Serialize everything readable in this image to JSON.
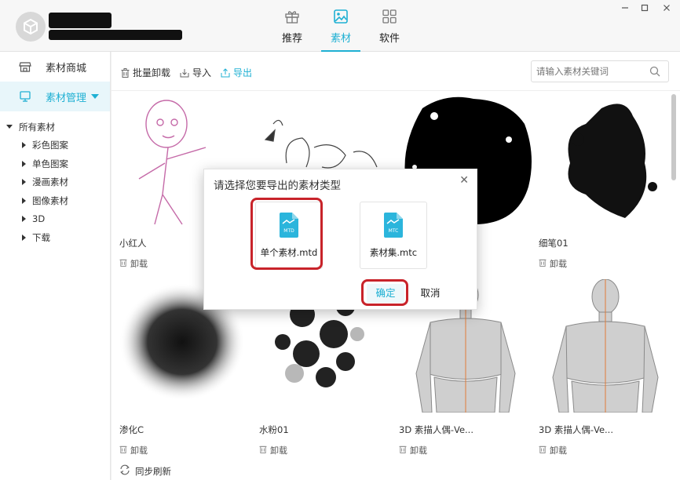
{
  "header": {
    "tabs": [
      {
        "label": "推荐",
        "icon": "gift-icon"
      },
      {
        "label": "素材",
        "icon": "image-icon",
        "active": true
      },
      {
        "label": "软件",
        "icon": "grid-icon"
      }
    ],
    "window_controls": [
      "minimize-icon",
      "maximize-icon",
      "close-icon"
    ]
  },
  "sidebar": {
    "items": [
      {
        "label": "素材商城",
        "icon": "store-icon"
      },
      {
        "label": "素材管理",
        "icon": "monitor-icon",
        "active": true
      }
    ],
    "tree": {
      "root": "所有素材",
      "children": [
        "彩色图案",
        "单色图案",
        "漫画素材",
        "图像素材",
        "3D",
        "下载"
      ]
    }
  },
  "toolbar": {
    "batch_uninstall": "批量卸载",
    "import": "导入",
    "export": "导出",
    "search_placeholder": "请输入素材关键词"
  },
  "materials": [
    {
      "name": "小红人",
      "action": "卸载"
    },
    {
      "name": "",
      "action": ""
    },
    {
      "name": "",
      "action": ""
    },
    {
      "name": "细笔01",
      "action": "卸载"
    },
    {
      "name": "渗化C",
      "action": "卸载"
    },
    {
      "name": "水粉01",
      "action": "卸载"
    },
    {
      "name": "3D 素描人偶-Ve...",
      "action": "卸载"
    },
    {
      "name": "3D 素描人偶-Ve...",
      "action": "卸载"
    }
  ],
  "footer": {
    "sync": "同步刷新"
  },
  "dialog": {
    "title": "请选择您要导出的素材类型",
    "options": [
      {
        "label": "单个素材.mtd",
        "badge": "MTD"
      },
      {
        "label": "素材集.mtc",
        "badge": "MTC"
      }
    ],
    "ok": "确定",
    "cancel": "取消"
  },
  "colors": {
    "accent": "#1fb0d3",
    "highlight": "#c8232a"
  }
}
